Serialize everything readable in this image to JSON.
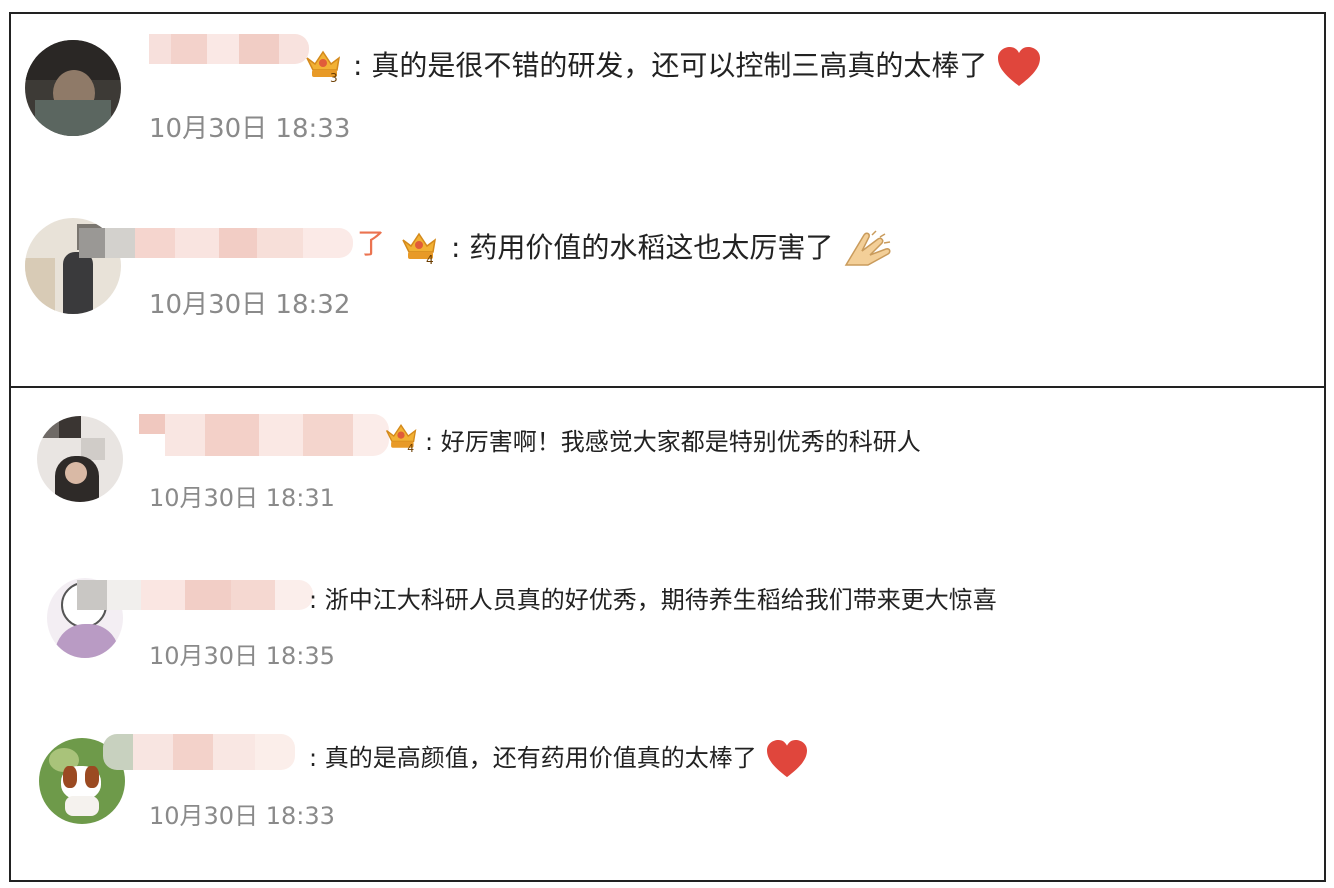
{
  "colors": {
    "border": "#222222",
    "timestamp": "#8a8a8a",
    "username_accent": "#eb7350",
    "blur_pink": "#f4d6d0",
    "heart_red": "#e0463c"
  },
  "comments": [
    {
      "username_visible_tail": "",
      "crown_level": "3",
      "separator": ":",
      "text": "真的是很不错的研发，还可以控制三高真的太棒了",
      "emoji": "heart-icon",
      "time": "10月30日 18:33"
    },
    {
      "username_visible_tail": "了",
      "crown_level": "4",
      "separator": ":",
      "text": "药用价值的水稻这也太厉害了",
      "emoji": "clap-icon",
      "time": "10月30日 18:32"
    },
    {
      "username_visible_tail": "",
      "crown_level": "4",
      "separator": ":",
      "text": "好厉害啊！我感觉大家都是特别优秀的科研人",
      "emoji": "",
      "time": "10月30日 18:31"
    },
    {
      "username_visible_tail": "",
      "crown_level": "",
      "separator": ":",
      "text": "浙中江大科研人员真的好优秀，期待养生稻给我们带来更大惊喜",
      "emoji": "",
      "time": "10月30日 18:35"
    },
    {
      "username_visible_tail": "",
      "crown_level": "",
      "separator": ":",
      "text": "真的是高颜值，还有药用价值真的太棒了",
      "emoji": "heart-icon",
      "time": "10月30日 18:33"
    }
  ]
}
